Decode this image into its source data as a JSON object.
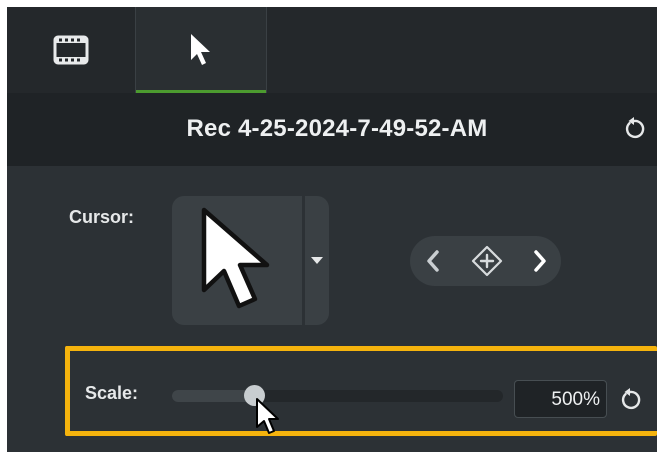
{
  "tabs": [
    {
      "name": "Media",
      "icon": "film-strip-icon",
      "active": false
    },
    {
      "name": "Cursor",
      "icon": "mouse-pointer-icon",
      "active": true
    }
  ],
  "header": {
    "title": "Rec 4-25-2024-7-49-52-AM",
    "reset_icon": "reset-icon"
  },
  "cursor": {
    "label": "Cursor:",
    "preview_icon": "arrow-cursor-icon",
    "dropdown_icon": "caret-down-icon",
    "nav": {
      "prev_icon": "chevron-left-icon",
      "add_icon": "add-keyframe-icon",
      "next_icon": "chevron-right-icon"
    }
  },
  "scale": {
    "label": "Scale:",
    "value": "500%",
    "slider_level": 0.25,
    "reset_icon": "reset-icon"
  },
  "colors": {
    "panel": "#2c3135",
    "active_tab_accent": "#4c9b2f",
    "highlight": "#f5b30d"
  }
}
